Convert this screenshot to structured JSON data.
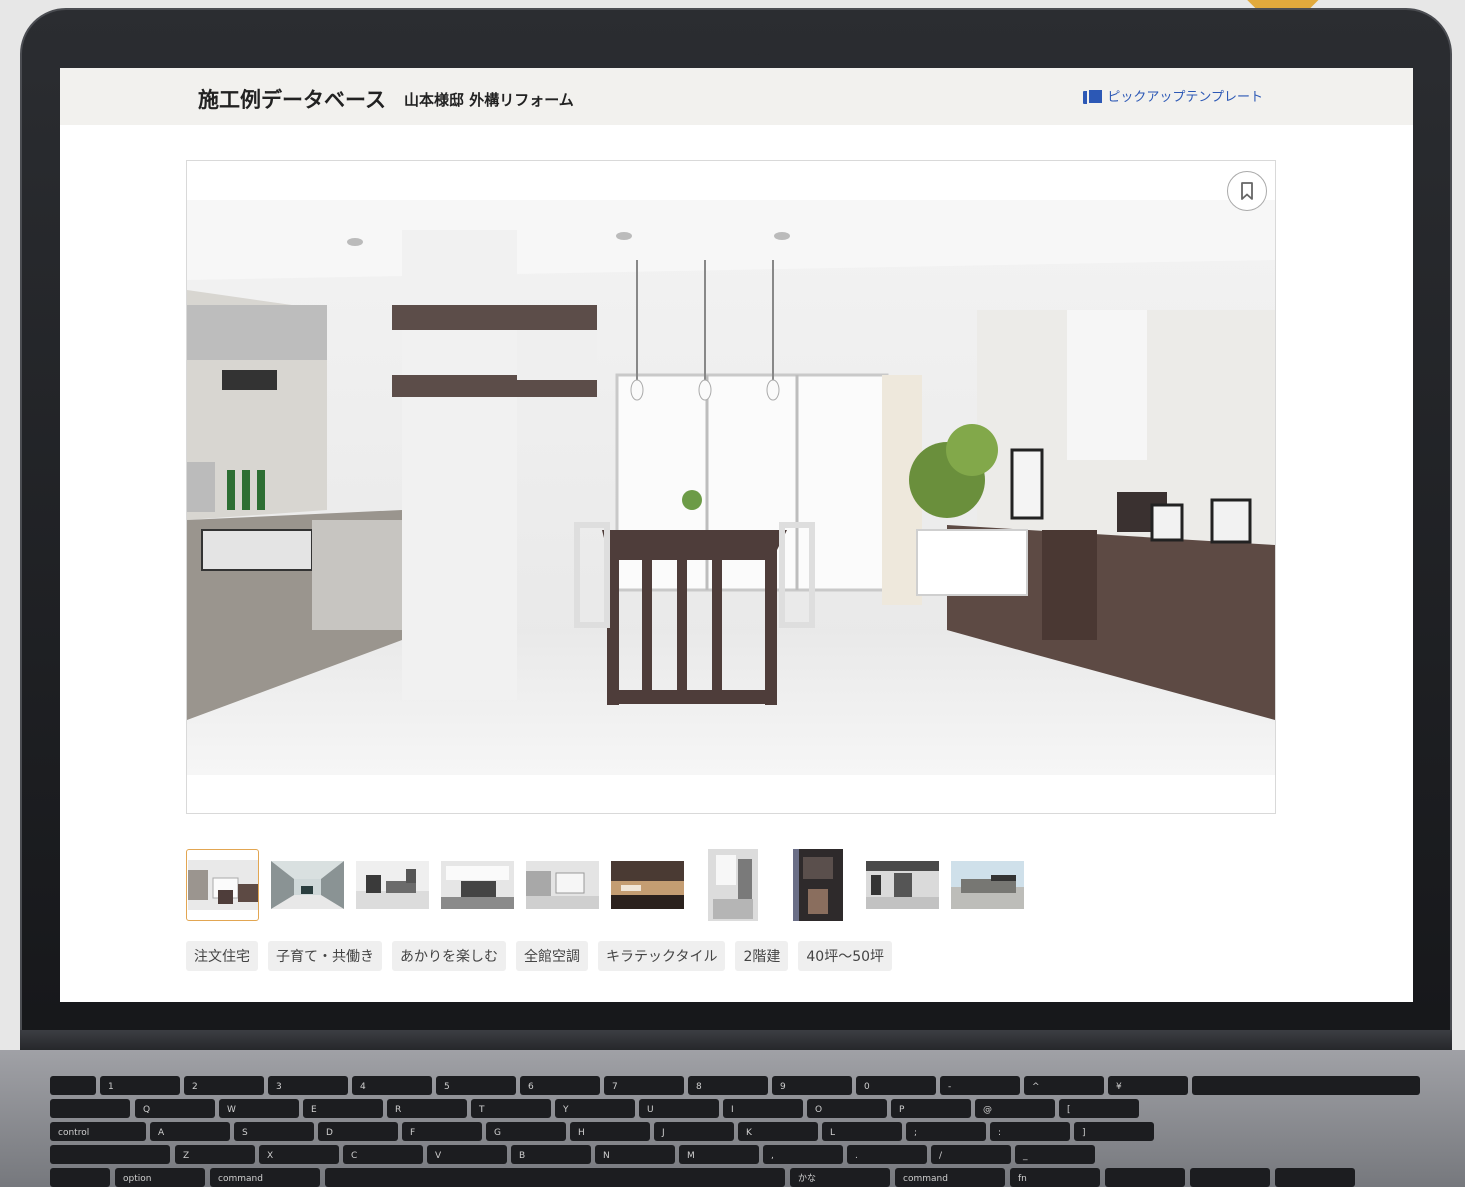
{
  "header": {
    "title": "施工例データベース",
    "subtitle": "山本様邸 外構リフォーム",
    "pickup_label": "ピックアップテンプレート"
  },
  "icons": {
    "pickup": "book-copy-icon",
    "bookmark": "bookmark-icon"
  },
  "gallery": {
    "thumbnail_count": 10,
    "active_index": 0
  },
  "tags": [
    "注文住宅",
    "子育て・共働き",
    "あかりを楽しむ",
    "全館空調",
    "キラテックタイル",
    "2階建",
    "40坪〜50坪"
  ],
  "keyboard": {
    "row1": [
      "1",
      "2",
      "3",
      "4",
      "5",
      "6",
      "7",
      "8",
      "9",
      "0",
      "-",
      "^",
      "¥"
    ],
    "row2": [
      "Q",
      "W",
      "E",
      "R",
      "T",
      "Y",
      "U",
      "I",
      "O",
      "P",
      "@",
      "["
    ],
    "row3": [
      "A",
      "S",
      "D",
      "F",
      "G",
      "H",
      "J",
      "K",
      "L",
      ";",
      ":",
      "]"
    ],
    "row4": [
      "Z",
      "X",
      "C",
      "V",
      "B",
      "N",
      "M",
      ",",
      ".",
      "/",
      "_"
    ],
    "control": "control",
    "option": "option",
    "command": "command",
    "kana": "かな",
    "fn": "fn"
  },
  "colors": {
    "accent_thumb_border": "#e2a652",
    "link": "#2c58b5",
    "header_bg": "#f2f1ee"
  }
}
